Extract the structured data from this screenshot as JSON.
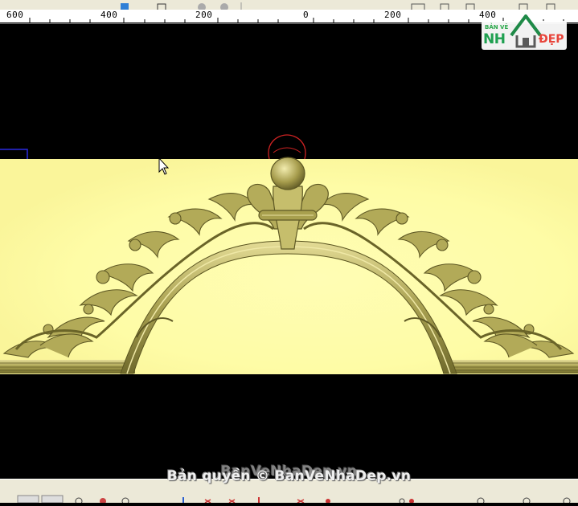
{
  "ruler": {
    "labels": [
      "600",
      "400",
      "200",
      "0",
      "200",
      "400"
    ]
  },
  "logo": {
    "line1": "BẢN VẼ",
    "line2": "NH",
    "line3": "ĐẸP"
  },
  "watermark": {
    "text": "Bản quyền © BanVeNhaDep.vn",
    "ghost": "BanVeNhaDep.vn"
  },
  "colors": {
    "canvas_bg": "#000000",
    "panel_yellow": "#fefcaa",
    "carving_gold": "#b8b060",
    "carving_dark": "#6e6a30",
    "selection_red": "#cc0000",
    "ui_gray": "#ece9d8"
  }
}
